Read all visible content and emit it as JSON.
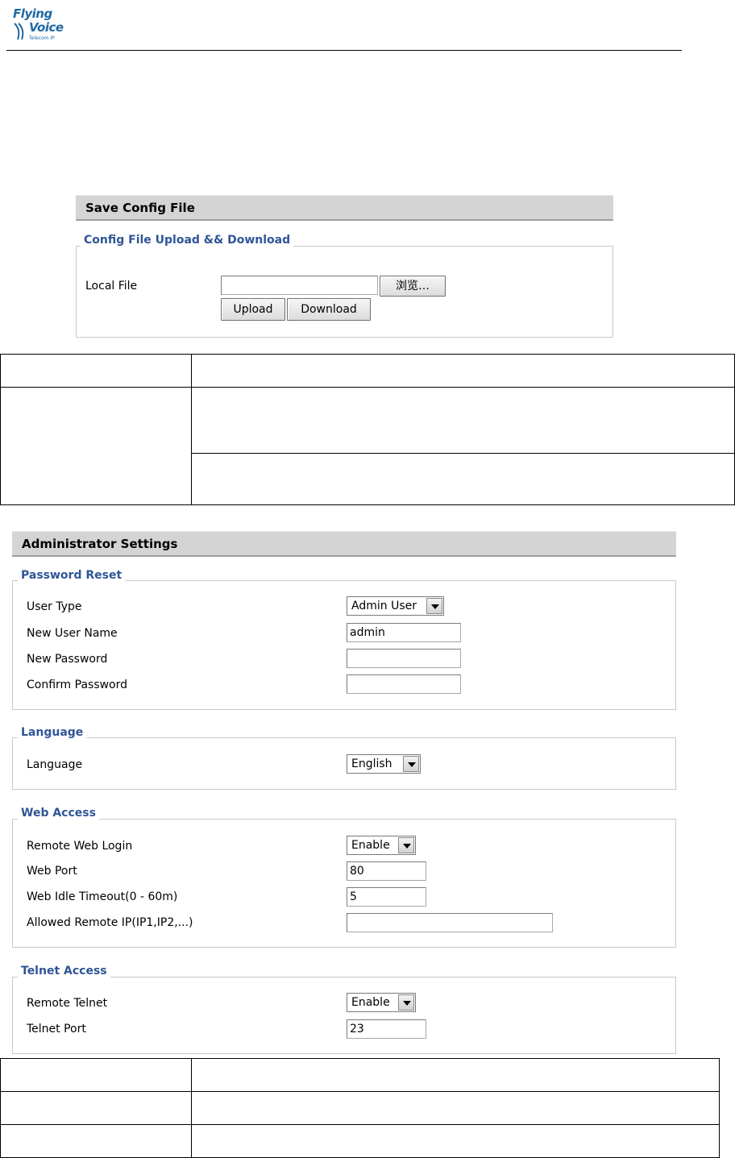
{
  "logo": {
    "line1": "Flying",
    "line2": "Voice",
    "tagline": "Telecom IP"
  },
  "save_config": {
    "title": "Save Config File",
    "legend": "Config File Upload && Download",
    "local_file_label": "Local File",
    "local_file_value": "",
    "browse_label": "浏览…",
    "upload_label": "Upload",
    "download_label": "Download"
  },
  "admin": {
    "title": "Administrator Settings",
    "password_reset": {
      "legend": "Password Reset",
      "user_type_label": "User Type",
      "user_type_value": "Admin User",
      "new_user_name_label": "New User Name",
      "new_user_name_value": "admin",
      "new_password_label": "New Password",
      "new_password_value": "",
      "confirm_password_label": "Confirm Password",
      "confirm_password_value": ""
    },
    "language": {
      "legend": "Language",
      "language_label": "Language",
      "language_value": "English"
    },
    "web_access": {
      "legend": "Web Access",
      "remote_web_login_label": "Remote Web Login",
      "remote_web_login_value": "Enable",
      "web_port_label": "Web Port",
      "web_port_value": "80",
      "web_idle_timeout_label": "Web Idle Timeout(0 - 60m)",
      "web_idle_timeout_value": "5",
      "allowed_remote_ip_label": "Allowed Remote IP(IP1,IP2,...)",
      "allowed_remote_ip_value": ""
    },
    "telnet_access": {
      "legend": "Telnet Access",
      "remote_telnet_label": "Remote Telnet",
      "remote_telnet_value": "Enable",
      "telnet_port_label": "Telnet Port",
      "telnet_port_value": "23"
    }
  }
}
